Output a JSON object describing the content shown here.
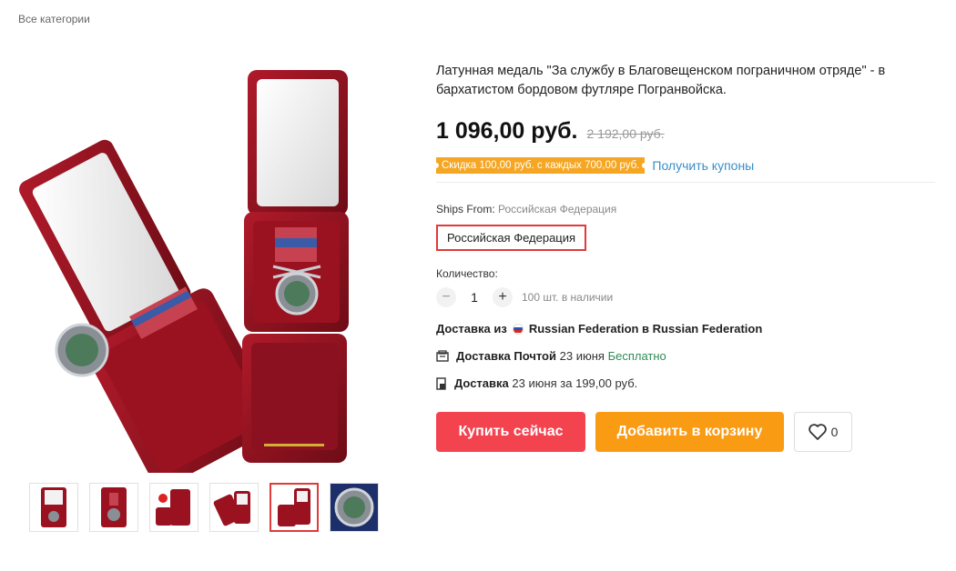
{
  "breadcrumb": "Все категории",
  "product": {
    "title": "Латунная медаль \"За службу в Благовещенском пограничном отряде\" - в бархатистом бордовом футляре Погранвойска.",
    "price": "1 096,00 руб.",
    "old_price": "2 192,00 руб.",
    "coupon_text": "Скидка 100,00 руб. с каждых 700,00 руб.",
    "coupon_link": "Получить купоны",
    "ships_from_label": "Ships From:",
    "ships_from_value": "Российская Федерация",
    "option_selected": "Российская Федерация",
    "quantity_label": "Количество:",
    "quantity": "1",
    "stock": "100 шт. в наличии",
    "delivery_from_prefix": "Доставка из",
    "delivery_from_route": "Russian Federation в Russian Federation",
    "delivery_post_label": "Доставка Почтой",
    "delivery_post_date": "23 июня",
    "delivery_post_price": "Бесплатно",
    "delivery_label": "Доставка",
    "delivery_date": "23 июня за 199,00 руб.",
    "buy_now": "Купить сейчас",
    "add_to_cart": "Добавить в корзину",
    "wishlist_count": "0"
  },
  "colors": {
    "accent_red": "#f2434f",
    "accent_orange": "#fa9b14",
    "coupon": "#f5a623",
    "link": "#3a8ec9",
    "free": "#2e8b57"
  },
  "icons": {
    "flag": "russia-flag-icon",
    "post": "post-icon",
    "truck": "delivery-icon",
    "heart": "heart-icon",
    "minus": "minus-icon",
    "plus": "plus-icon"
  }
}
